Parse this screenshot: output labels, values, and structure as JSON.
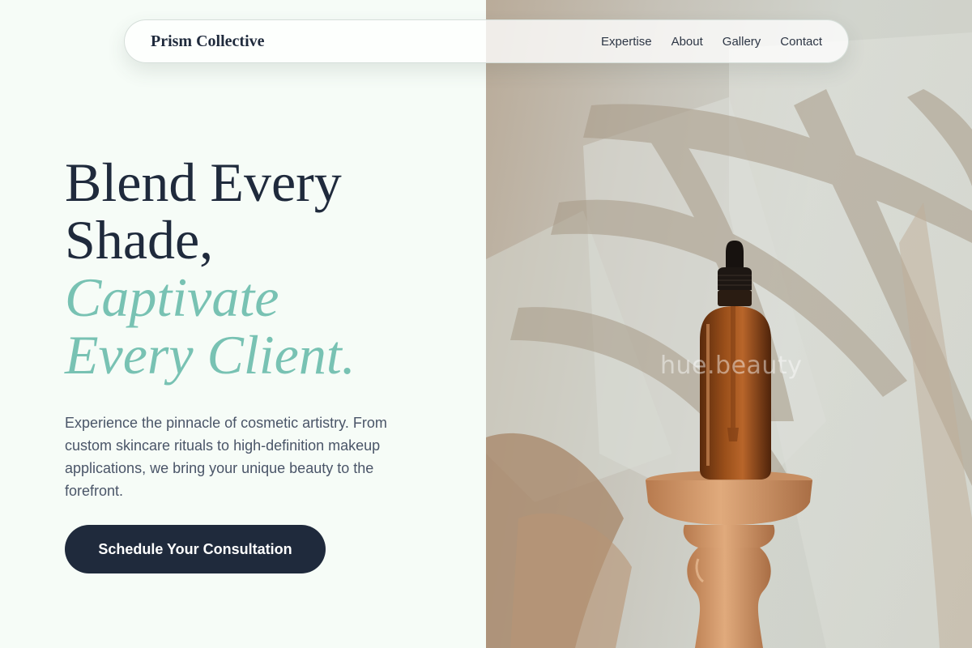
{
  "nav": {
    "brand": "Prism Collective",
    "links": [
      "Expertise",
      "About",
      "Gallery",
      "Contact"
    ]
  },
  "hero": {
    "headline_line1": "Blend Every",
    "headline_line2": "Shade,",
    "headline_accent_line1": "Captivate",
    "headline_accent_line2": "Every Client.",
    "description": "Experience the pinnacle of cosmetic artistry. From custom skincare rituals to high-definition makeup applications, we bring your unique beauty to the forefront.",
    "cta_label": "Schedule Your Consultation"
  },
  "image": {
    "subject": "amber-dropper-bottle-on-wooden-pedestal",
    "watermark": "hue.beauty"
  },
  "colors": {
    "background": "#f6fcf7",
    "ink": "#1f2a3c",
    "accent": "#78c2b3",
    "body_text": "#4a5568"
  }
}
